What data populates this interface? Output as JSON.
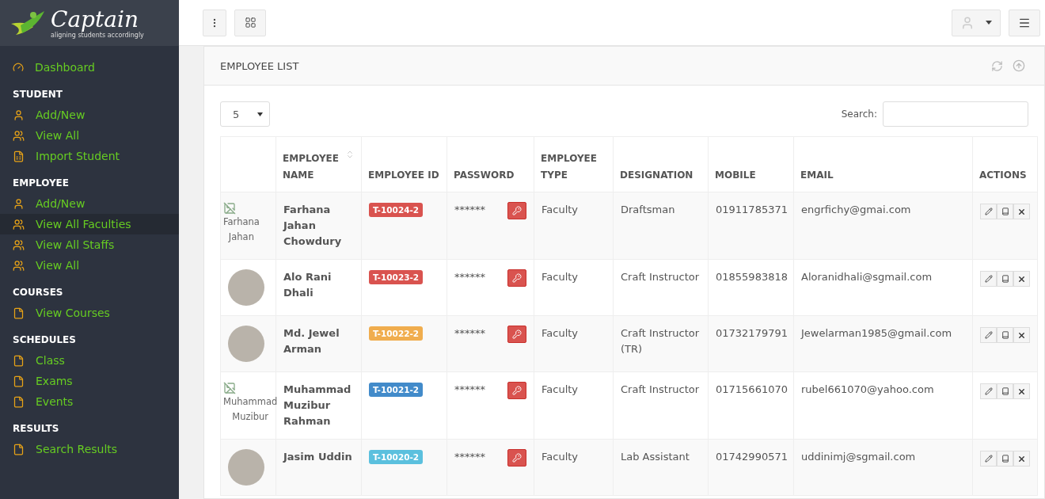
{
  "logo": {
    "name": "Captain",
    "tagline": "aligning students accordingly"
  },
  "sidebar": {
    "sections": [
      {
        "items": [
          {
            "label": "Dashboard",
            "kind": "dashboard",
            "selected": false
          }
        ]
      },
      {
        "heading": "STUDENT",
        "items": [
          {
            "label": "Add/New",
            "kind": "add",
            "selected": false
          },
          {
            "label": "View All",
            "kind": "list",
            "selected": false
          },
          {
            "label": "Import Student",
            "kind": "import",
            "selected": false
          }
        ]
      },
      {
        "heading": "EMPLOYEE",
        "items": [
          {
            "label": "Add/New",
            "kind": "add",
            "selected": false
          },
          {
            "label": "View All Faculties",
            "kind": "list",
            "selected": true
          },
          {
            "label": "View All Staffs",
            "kind": "list",
            "selected": false
          },
          {
            "label": "View All",
            "kind": "list",
            "selected": false
          }
        ]
      },
      {
        "heading": "COURSES",
        "items": [
          {
            "label": "View Courses",
            "kind": "page",
            "selected": false
          }
        ]
      },
      {
        "heading": "SCHEDULES",
        "items": [
          {
            "label": "Class",
            "kind": "page",
            "selected": false
          },
          {
            "label": "Exams",
            "kind": "page",
            "selected": false
          },
          {
            "label": "Events",
            "kind": "page",
            "selected": false
          }
        ]
      },
      {
        "heading": "RESULTS",
        "items": [
          {
            "label": "Search Results",
            "kind": "page",
            "selected": false
          }
        ]
      }
    ]
  },
  "panel": {
    "title": "EMPLOYEE LIST",
    "page_size": "5",
    "search_label": "Search:",
    "columns": [
      {},
      {
        "label": "EMPLOYEE NAME",
        "sortable": true
      },
      {
        "label": "EMPLOYEE ID",
        "sortable": false
      },
      {
        "label": "PASSWORD",
        "sortable": false
      },
      {
        "label": "EMPLOYEE TYPE",
        "sortable": false
      },
      {
        "label": "DESIGNATION",
        "sortable": false
      },
      {
        "label": "MOBILE",
        "sortable": false
      },
      {
        "label": "EMAIL",
        "sortable": false
      },
      {
        "label": "ACTIONS",
        "sortable": false
      }
    ],
    "rows": [
      {
        "photo": {
          "kind": "broken",
          "alt": "Farhana Jahan"
        },
        "name": "Farhana Jahan Chowdury",
        "id": "T-10024-2",
        "color": "#d9534f",
        "password": "******",
        "type": "Faculty",
        "designation": "Draftsman",
        "mobile": "01911785371",
        "email": "engrfichy@gmai.com"
      },
      {
        "photo": {
          "kind": "photo"
        },
        "name": "Alo Rani Dhali",
        "id": "T-10023-2",
        "color": "#d9534f",
        "password": "******",
        "type": "Faculty",
        "designation": "Craft Instructor",
        "mobile": "01855983818",
        "email": "Aloranidhali@sgmail.com"
      },
      {
        "photo": {
          "kind": "photo"
        },
        "name": "Md. Jewel Arman",
        "id": "T-10022-2",
        "color": "#f0ad4e",
        "password": "******",
        "type": "Faculty",
        "designation": "Craft Instructor (TR)",
        "mobile": "01732179791",
        "email": "Jewelarman1985@gmail.com"
      },
      {
        "photo": {
          "kind": "broken",
          "alt": "Muhammad Muzibur"
        },
        "name": "Muhammad Muzibur Rahman",
        "id": "T-10021-2",
        "color": "#428bca",
        "password": "******",
        "type": "Faculty",
        "designation": "Craft Instructor",
        "mobile": "01715661070",
        "email": "rubel661070@yahoo.com"
      },
      {
        "photo": {
          "kind": "photo"
        },
        "name": "Jasim Uddin",
        "id": "T-10020-2",
        "color": "#5bc0de",
        "password": "******",
        "type": "Faculty",
        "designation": "Lab Assistant",
        "mobile": "01742990571",
        "email": "uddinimj@sgmail.com"
      }
    ]
  }
}
